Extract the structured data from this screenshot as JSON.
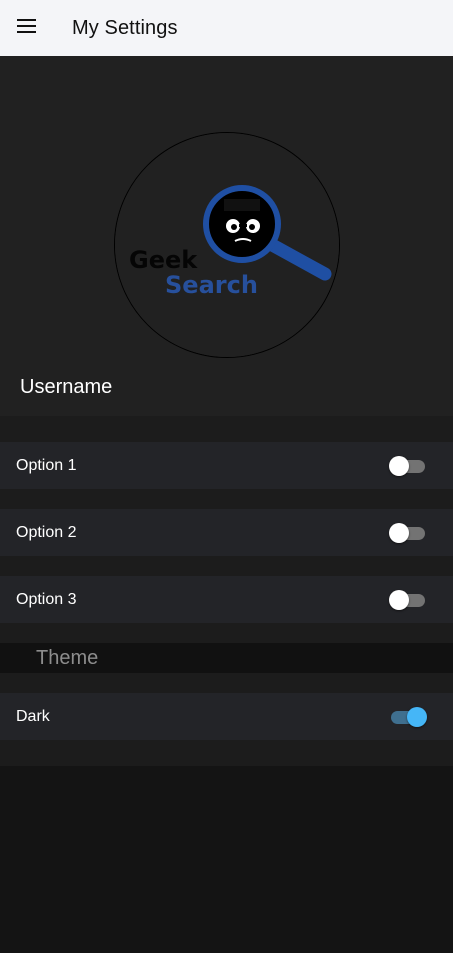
{
  "toolbar": {
    "title": "My Settings",
    "menu_icon": "hamburger-menu-icon"
  },
  "profile": {
    "avatar": {
      "logo_text_top": "Geek",
      "logo_text_bottom": "Search",
      "brand_color": "#1f4fa3"
    },
    "username": "Username"
  },
  "options": [
    {
      "label": "Option 1",
      "enabled": false
    },
    {
      "label": "Option 2",
      "enabled": false
    },
    {
      "label": "Option 3",
      "enabled": false
    }
  ],
  "theme": {
    "header": "Theme",
    "items": [
      {
        "label": "Dark",
        "enabled": true
      }
    ]
  },
  "colors": {
    "toggle_on": "#45b6f7",
    "toggle_off": "#ffffff"
  }
}
